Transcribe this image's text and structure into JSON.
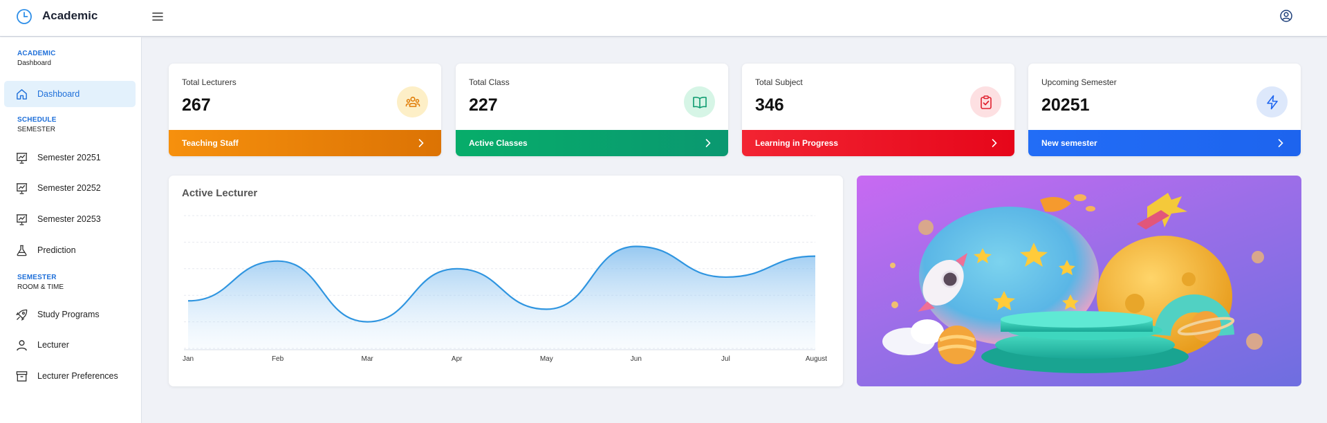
{
  "header": {
    "brand": "Academic",
    "logo_icon": "clock-icon",
    "menu_icon": "hamburger-icon",
    "user_icon": "user-circle-icon"
  },
  "sidebar": {
    "sections": [
      {
        "title": "ACADEMIC",
        "subtitle": "Dashboard",
        "items": [
          {
            "label": "Dashboard",
            "icon": "home-icon",
            "active": true
          }
        ]
      },
      {
        "title": "SCHEDULE",
        "subtitle": "SEMESTER",
        "items": [
          {
            "label": "Semester 20251",
            "icon": "presentation-chart-icon"
          },
          {
            "label": "Semester 20252",
            "icon": "presentation-chart-icon"
          },
          {
            "label": "Semester 20253",
            "icon": "presentation-chart-icon"
          },
          {
            "label": "Prediction",
            "icon": "flask-icon"
          }
        ]
      },
      {
        "title": "SEMESTER",
        "subtitle": "ROOM & TIME",
        "items": [
          {
            "label": "Study Programs",
            "icon": "rocket-icon"
          },
          {
            "label": "Lecturer",
            "icon": "user-icon"
          },
          {
            "label": "Lecturer Preferences",
            "icon": "archive-icon"
          }
        ]
      }
    ]
  },
  "cards": [
    {
      "title": "Total Lecturers",
      "value": "267",
      "footer": "Teaching Staff",
      "icon": "users-icon",
      "color": "#f28c0c",
      "color2": "#e07b05",
      "icon_bg": "#fdefc7",
      "icon_color": "#e07b05"
    },
    {
      "title": "Total Class",
      "value": "227",
      "footer": "Active Classes",
      "icon": "book-open-icon",
      "color": "#08a868",
      "color2": "#0a9a6e",
      "icon_bg": "#d6f5e6",
      "icon_color": "#0a9a6e"
    },
    {
      "title": "Total Subject",
      "value": "346",
      "footer": "Learning in Progress",
      "icon": "clipboard-check-icon",
      "color": "#f0202e",
      "color2": "#e6081c",
      "icon_bg": "#fde0e2",
      "icon_color": "#e0202e"
    },
    {
      "title": "Upcoming Semester",
      "value": "20251",
      "footer": "New semester",
      "icon": "lightning-icon",
      "color": "#1f6cf5",
      "color2": "#1e66f0",
      "icon_bg": "#dde8fb",
      "icon_color": "#1e66f0"
    }
  ],
  "chart": {
    "title": "Active Lecturer"
  },
  "chart_data": {
    "type": "area",
    "x": [
      "Jan",
      "Feb",
      "Mar",
      "Apr",
      "May",
      "Jun",
      "Jul",
      "August"
    ],
    "values": [
      0.18,
      0.75,
      -0.12,
      0.64,
      0.06,
      0.96,
      0.52,
      0.82
    ],
    "ylim": [
      -0.5,
      1.4
    ],
    "grid": true,
    "color": "#2f95e0",
    "title": "Active Lecturer"
  },
  "illustration": {
    "icon": "space-rocket-illustration"
  }
}
